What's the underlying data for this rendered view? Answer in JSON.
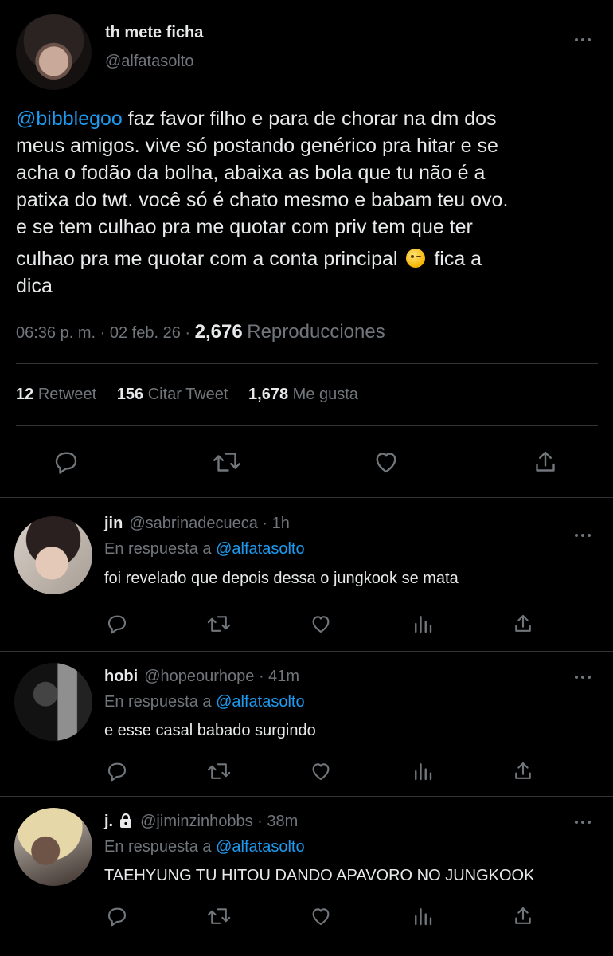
{
  "tweet": {
    "display_name": "th mete ficha",
    "handle": "@alfatasolto",
    "mention": "@bibblegoo",
    "lines": [
      " faz favor filho e para de chorar na dm dos",
      "meus amigos. vive só postando genérico pra hitar e se",
      "acha o fodão da bolha, abaixa as bola que tu não é a",
      "patixa do twt. você só é chato mesmo e babam teu ovo.",
      "e se tem culhao pra me quotar com priv tem que ter",
      "culhao pra me quotar com a conta principal",
      " fica a",
      "dica"
    ],
    "emoji": "winking-face",
    "time": "06:36 p. m.",
    "date": "02 feb. 26",
    "separator": "·",
    "views_count": "2,676",
    "views_label": "Reproducciones",
    "retweets_count": "12",
    "retweets_label": "Retweet",
    "quotes_count": "156",
    "quotes_label": "Citar Tweet",
    "likes_count": "1,678",
    "likes_label": "Me gusta"
  },
  "replies": [
    {
      "name": "jin",
      "handle": "@sabrinadecueca · 1h",
      "reply_prefix": "En respuesta a ",
      "reply_to": "@alfatasolto",
      "text": "foi revelado que depois dessa o jungkook se mata",
      "locked": false
    },
    {
      "name": "hobi",
      "handle": "@hopeourhope · 41m",
      "reply_prefix": "En respuesta a ",
      "reply_to": "@alfatasolto",
      "text": "e esse casal babado surgindo",
      "locked": false
    },
    {
      "name": "j.",
      "handle": "@jiminzinhobbs · 38m",
      "reply_prefix": "En respuesta a ",
      "reply_to": "@alfatasolto",
      "text": "TAEHYUNG TU HITOU DANDO APAVORO NO JUNGKOOK",
      "locked": true
    }
  ],
  "colors": {
    "background": "#000000",
    "text": "#e7e9ea",
    "secondary": "#71767b",
    "accent": "#1d9bf0",
    "border": "#2f3336"
  },
  "icons": [
    "reply-icon",
    "retweet-icon",
    "like-icon",
    "share-icon",
    "views-icon",
    "more-icon",
    "lock-icon"
  ]
}
